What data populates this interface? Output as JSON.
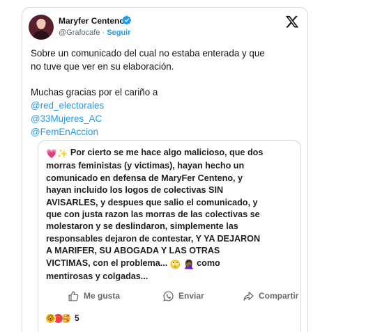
{
  "author": {
    "name": "Maryfer Centeno",
    "handle": "@Grafocafe",
    "separator": "·",
    "follow_label": "Seguir",
    "verified_icon": "verified-badge-icon"
  },
  "platform_icon": "x-logo-icon",
  "tweet": {
    "line1": "Sobre un comunicado del cual no estaba enterada y que",
    "line2": "no tuve que ver en su elaboración.",
    "thanks": "Muchas gracias por el cariño a",
    "mentions": [
      "@red_electorales",
      "@33Mujeres_AC",
      "@FemEnAccion"
    ]
  },
  "embed": {
    "lines": [
      "Por cierto se me hace algo malicioso, que dos",
      "morras feministas (y victimas), hayan hecho un",
      "comunicado en defensa de MaryFer Centeno, y",
      "hayan incluido los logos de colectivas SIN",
      "AVISARLES, y despues que salio el comunicado, y",
      "que con justa razon las morras de las colectivas se",
      "molestaron y se deslindaron, simplemente las",
      "responsables dejaron de contestar, Y YA DEJARON",
      "A MARIFER, SU ABOGADA Y LAS OTRAS",
      "VICTIMAS, con el problema...",
      "como",
      "mentirosas y colgadas..."
    ],
    "lead_emojis": [
      "💗",
      "✨"
    ],
    "inline_emojis": [
      "🙄",
      "🤦🏾‍♀️"
    ],
    "actions": {
      "like": "Me gusta",
      "send": "Enviar",
      "share": "Compartir"
    },
    "reactions": {
      "emojis": [
        "😮",
        "❤️",
        "🥰"
      ],
      "count": "5"
    },
    "colors": {
      "action_text": "#65676b",
      "mention": "#1d9bf0",
      "follow": "#1d9bf0"
    }
  }
}
